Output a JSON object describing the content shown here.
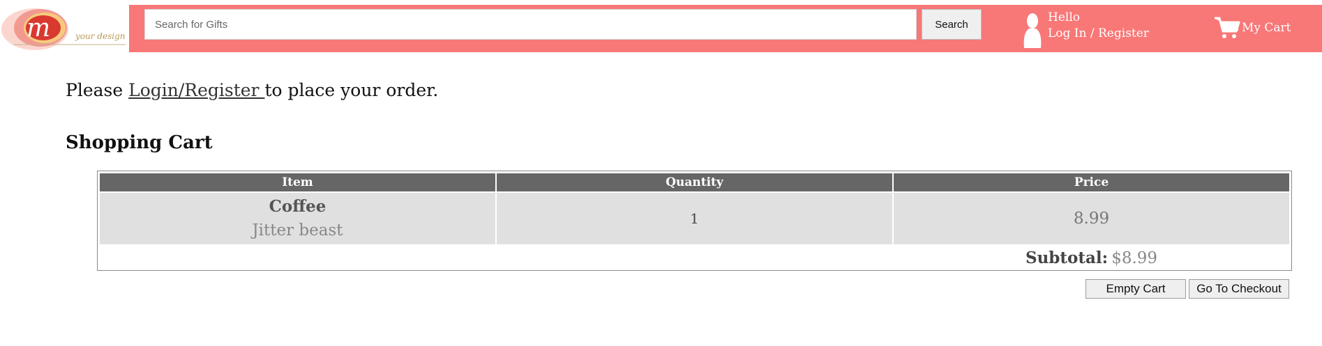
{
  "header": {
    "logo_alt": "your design",
    "search": {
      "placeholder": "Search for Gifts",
      "value": "",
      "button_label": "Search"
    },
    "greeting": "Hello",
    "login_register": "Log In / Register",
    "cart_label": "My Cart",
    "bar_color": "#f87777"
  },
  "notice": {
    "prefix": "Please ",
    "link": "Login/Register ",
    "suffix": "to place your order."
  },
  "cart": {
    "title": "Shopping Cart",
    "columns": [
      "Item",
      "Quantity",
      "Price"
    ],
    "rows": [
      {
        "name": "Coffee",
        "description": "Jitter beast",
        "quantity": "1",
        "price": "8.99"
      }
    ],
    "subtotal_label": "Subtotal:",
    "subtotal_value": "$8.99",
    "empty_button": "Empty Cart",
    "checkout_button": "Go To Checkout"
  },
  "colors": {
    "header_row": "#666666",
    "body_row": "#e0e0e0"
  }
}
